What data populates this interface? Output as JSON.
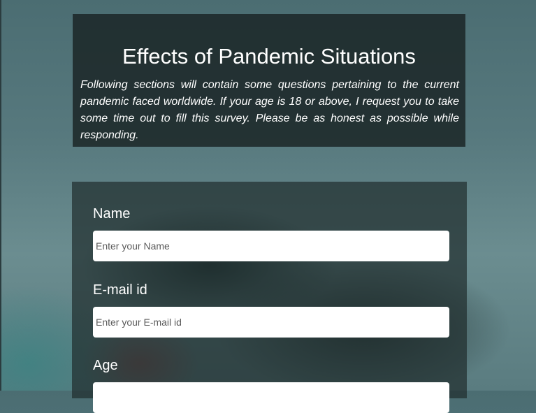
{
  "header": {
    "title": "Effects of Pandemic Situations",
    "description": "Following sections will contain some questions pertaining to the current pandemic faced worldwide. If your age is 18 or above, I request you to take some time out to fill this survey. Please be as honest as possible while responding."
  },
  "form": {
    "name": {
      "label": "Name",
      "placeholder": "Enter your Name",
      "value": ""
    },
    "email": {
      "label": "E-mail id",
      "placeholder": "Enter your E-mail id",
      "value": ""
    },
    "age": {
      "label": "Age",
      "placeholder": "",
      "value": ""
    }
  }
}
